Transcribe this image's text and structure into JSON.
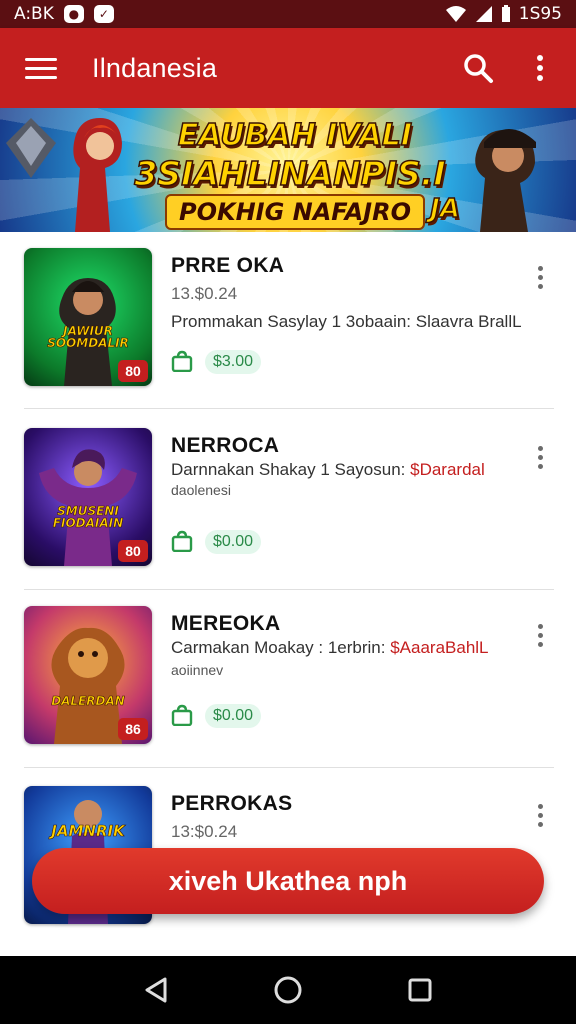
{
  "status_bar": {
    "time": "A:BK",
    "battery_text": "1S95"
  },
  "app_bar": {
    "title": "Ilndanesia"
  },
  "banner": {
    "line1": "EAUBAH IVALI",
    "line2": "3SIAHLINANPIS.I",
    "line3": "POKHIG NAFAJRO",
    "line4": "JA"
  },
  "items": [
    {
      "title": "PRRE OKA",
      "subtitle": "13.$0.24",
      "description": "Prommakan Sasylay 1 3obaain: Slaavra BrallL",
      "description_accent": "",
      "extra": "",
      "price": "$3.00",
      "badge": "80",
      "thumb_title": "JAWIUR SOOMDALIR",
      "colors": [
        "#0c7a2a",
        "#1fe06a"
      ]
    },
    {
      "title": "NERROCA",
      "subtitle": "",
      "description": "Darnnakan Shakay 1 Sayosun: ",
      "description_accent": "$Darardal",
      "extra": "daolenesi",
      "price": "$0.00",
      "badge": "80",
      "thumb_title": "SMUSENI FIODAIAIN",
      "colors": [
        "#2a0d66",
        "#6b36f0"
      ]
    },
    {
      "title": "MEREOKA",
      "subtitle": "",
      "description": "Carmakan Moakay : 1erbrin: ",
      "description_accent": "$AaaraBahlL",
      "extra": "aoiinnev",
      "price": "$0.00",
      "badge": "86",
      "thumb_title": "DALERDAN",
      "colors": [
        "#7a1e86",
        "#f07a28"
      ]
    },
    {
      "title": "PERROKAS",
      "subtitle": "13:$0.24",
      "description": "",
      "description_accent": "",
      "extra": "",
      "price": "",
      "badge": "",
      "thumb_title": "JAMNRIK",
      "colors": [
        "#123a9a",
        "#3fa0ff"
      ]
    }
  ],
  "fab": {
    "label": "xiveh Ukathea nph"
  }
}
